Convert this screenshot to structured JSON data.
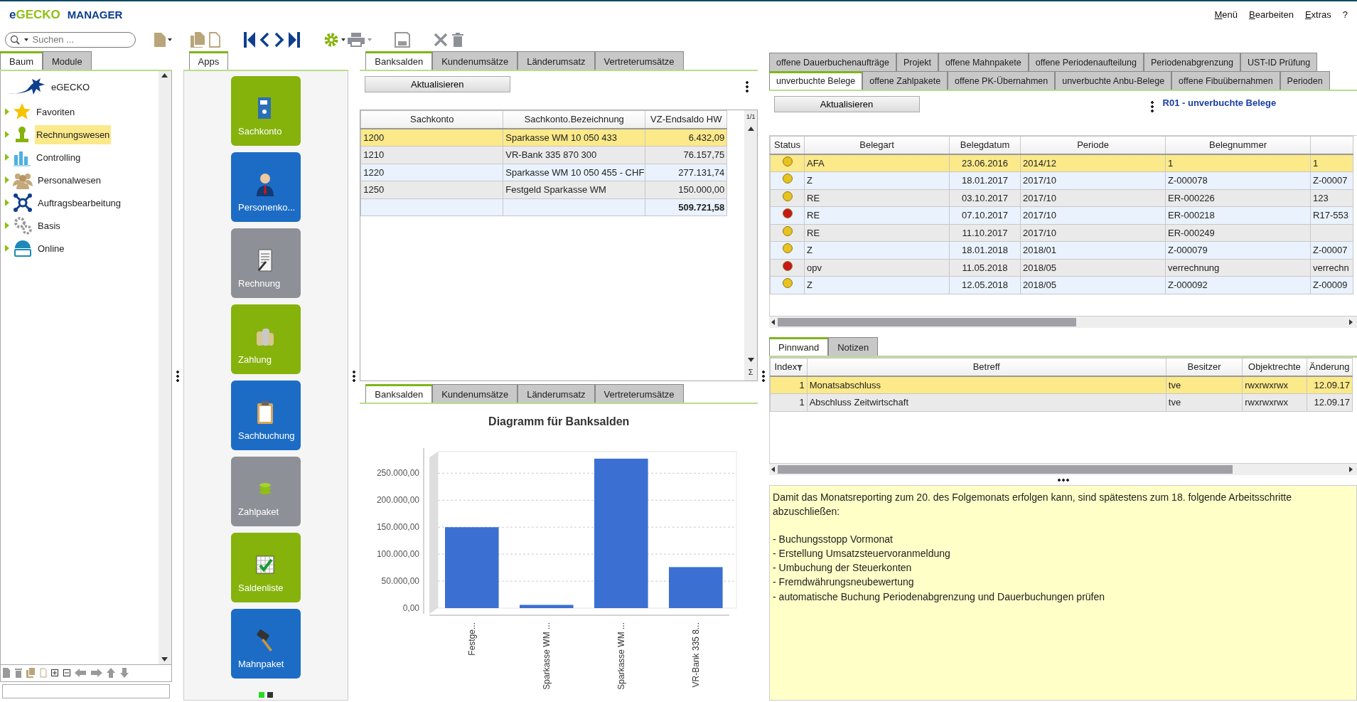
{
  "brand": {
    "prefix": "e",
    "main": "GECKO",
    "suffix": "MANAGER"
  },
  "menu": [
    {
      "label": "Menü",
      "underlined": true
    },
    {
      "label": "Bearbeiten",
      "underlined": true
    },
    {
      "label": "Extras",
      "underlined": true
    },
    {
      "label": "?",
      "underlined": false
    }
  ],
  "search": {
    "placeholder": "Suchen ..."
  },
  "left_panel": {
    "tabs": [
      {
        "label": "Baum",
        "selected": true
      },
      {
        "label": "Module",
        "selected": false
      }
    ],
    "tree": {
      "label": "eGECKO",
      "children": [
        {
          "label": "Favoriten",
          "selected": false,
          "expanded": false
        },
        {
          "label": "Rechnungswesen",
          "selected": true,
          "expanded": false
        },
        {
          "label": "Controlling",
          "selected": false,
          "expanded": false
        },
        {
          "label": "Personalwesen",
          "selected": false,
          "expanded": false
        },
        {
          "label": "Auftragsbearbeitung",
          "selected": false,
          "expanded": false
        },
        {
          "label": "Basis",
          "selected": false,
          "expanded": false
        },
        {
          "label": "Online",
          "selected": false,
          "expanded": false
        }
      ]
    }
  },
  "apps_panel": {
    "tabs": [
      {
        "label": "Apps",
        "selected": true
      }
    ],
    "tiles": [
      {
        "label": "Sachkonto",
        "color": "#86b20c"
      },
      {
        "label": "Personenko...",
        "color": "#1c6cc6"
      },
      {
        "label": "Rechnung",
        "color": "#8e9098"
      },
      {
        "label": "Zahlung",
        "color": "#86b20c"
      },
      {
        "label": "Sachbuchung",
        "color": "#1c6cc6"
      },
      {
        "label": "Zahlpaket",
        "color": "#8e9098"
      },
      {
        "label": "Saldenliste",
        "color": "#86b20c"
      },
      {
        "label": "Mahnpaket",
        "color": "#1c6cc6"
      }
    ],
    "pages": [
      {
        "selected": true
      },
      {
        "selected": false
      }
    ]
  },
  "balances_panel": {
    "tabs": [
      {
        "label": "Banksalden",
        "selected": true
      },
      {
        "label": "Kundenumsätze",
        "selected": false
      },
      {
        "label": "Länderumsatz",
        "selected": false
      },
      {
        "label": "Vertreterumsätze",
        "selected": false
      }
    ],
    "refresh_button": "Aktualisieren",
    "table": {
      "columns": [
        "Sachkonto",
        "Sachkonto.Bezeichnung",
        "VZ-Endsaldo HW"
      ],
      "rows": [
        {
          "cells": [
            "1200",
            "Sparkasse WM 10 050 433",
            "6.432,09"
          ],
          "selected": true
        },
        {
          "cells": [
            "1210",
            "VR-Bank 335 870 300",
            "76.157,75"
          ],
          "selected": false
        },
        {
          "cells": [
            "1220",
            "Sparkasse WM 10 050 455 - CHF",
            "277.131,74"
          ],
          "selected": false
        },
        {
          "cells": [
            "1250",
            "Festgeld Sparkasse WM",
            "150.000,00"
          ],
          "selected": false
        }
      ],
      "total": "509.721,58",
      "page_indicator": "1/1",
      "sum_symbol": "Σ"
    }
  },
  "chart_panel": {
    "tabs": [
      {
        "label": "Banksalden",
        "selected": true
      },
      {
        "label": "Kundenumsätze",
        "selected": false
      },
      {
        "label": "Länderumsatz",
        "selected": false
      },
      {
        "label": "Vertreterumsätze",
        "selected": false
      }
    ],
    "chart_data": {
      "type": "bar",
      "title": "Diagramm für Banksalden",
      "categories": [
        "Festge...",
        "Sparkasse WM ...",
        "Sparkasse WM ...",
        "VR-Bank 335 8..."
      ],
      "series": [
        {
          "color": "#3c6fd2",
          "values": [
            150000,
            6000,
            277000,
            76000
          ]
        }
      ],
      "grid": true,
      "ylim": [
        0,
        290000
      ],
      "yticks": [
        {
          "value": 0,
          "label": "0,00"
        },
        {
          "value": 50000,
          "label": "50.000,00"
        },
        {
          "value": 100000,
          "label": "100.000,00"
        },
        {
          "value": 150000,
          "label": "150.000,00"
        },
        {
          "value": 200000,
          "label": "200.000,00"
        },
        {
          "value": 250000,
          "label": "250.000,00"
        }
      ]
    }
  },
  "documents_panel": {
    "tab_rows": [
      [
        {
          "label": "offene Dauerbuchenaufträge",
          "selected": false
        },
        {
          "label": "Projekt",
          "selected": false
        },
        {
          "label": "offene Mahnpakete",
          "selected": false
        },
        {
          "label": "offene Periodenaufteilung",
          "selected": false
        },
        {
          "label": "Periodenabgrenzung",
          "selected": false
        },
        {
          "label": "UST-ID Prüfung",
          "selected": false
        }
      ],
      [
        {
          "label": "unverbuchte Belege",
          "selected": true
        },
        {
          "label": "offene Zahlpakete",
          "selected": false
        },
        {
          "label": "offene PK-Übernahmen",
          "selected": false
        },
        {
          "label": "unverbuchte Anbu-Belege",
          "selected": false
        },
        {
          "label": "offene Fibuübernahmen",
          "selected": false
        },
        {
          "label": "Perioden",
          "selected": false
        }
      ]
    ],
    "refresh_button": "Aktualisieren",
    "title": "R01 - unverbuchte Belege",
    "table": {
      "columns": [
        "Status",
        "Belegart",
        "Belegdatum",
        "Periode",
        "Belegnummer",
        ""
      ],
      "rows": [
        {
          "color": "#e8c21e",
          "cells": [
            "",
            "AFA",
            "23.06.2016",
            "2014/12",
            "1",
            "1"
          ],
          "selected": true
        },
        {
          "color": "#e8c21e",
          "cells": [
            "",
            "Z",
            "18.01.2017",
            "2017/10",
            "Z-000078",
            "Z-00007"
          ],
          "selected": false
        },
        {
          "color": "#e8c21e",
          "cells": [
            "",
            "RE",
            "03.10.2017",
            "2017/10",
            "ER-000226",
            "123"
          ],
          "selected": false
        },
        {
          "color": "#c81818",
          "cells": [
            "",
            "RE",
            "07.10.2017",
            "2017/10",
            "ER-000218",
            "R17-553"
          ],
          "selected": false
        },
        {
          "color": "#e8c21e",
          "cells": [
            "",
            "RE",
            "11.10.2017",
            "2017/10",
            "ER-000249",
            ""
          ],
          "selected": false
        },
        {
          "color": "#e8c21e",
          "cells": [
            "",
            "Z",
            "18.01.2018",
            "2018/01",
            "Z-000079",
            "Z-00007"
          ],
          "selected": false
        },
        {
          "color": "#c81818",
          "cells": [
            "",
            "opv",
            "11.05.2018",
            "2018/05",
            "verrechnung",
            "verrechn"
          ],
          "selected": false
        },
        {
          "color": "#e8c21e",
          "cells": [
            "",
            "Z",
            "12.05.2018",
            "2018/05",
            "Z-000092",
            "Z-00009"
          ],
          "selected": false
        }
      ]
    }
  },
  "pinboard_panel": {
    "tabs": [
      {
        "label": "Pinnwand",
        "selected": true
      },
      {
        "label": "Notizen",
        "selected": false
      }
    ],
    "table": {
      "columns": [
        "Index",
        "Betreff",
        "Besitzer",
        "Objektrechte",
        "Änderung"
      ],
      "rows": [
        {
          "cells": [
            "1",
            "Monatsabschluss",
            "tve",
            "rwxrwxrwx",
            "12.09.17"
          ],
          "selected": true
        },
        {
          "cells": [
            "1",
            "Abschluss Zeitwirtschaft",
            "tve",
            "rwxrwxrwx",
            "12.09.17"
          ],
          "selected": false
        }
      ]
    }
  },
  "note": {
    "text": "Damit das Monatsreporting zum 20. des Folgemonats erfolgen kann, sind spätestens zum 18. folgende Arbeitsschritte abzuschließen:",
    "items": [
      "- Buchungsstopp Vormonat",
      "- Erstellung Umsatzsteuervoranmeldung",
      "- Umbuchung der Steuerkonten",
      "- Fremdwährungsneubewertung",
      "- automatische Buchung Periodenabgrenzung und Dauerbuchungen prüfen"
    ]
  }
}
